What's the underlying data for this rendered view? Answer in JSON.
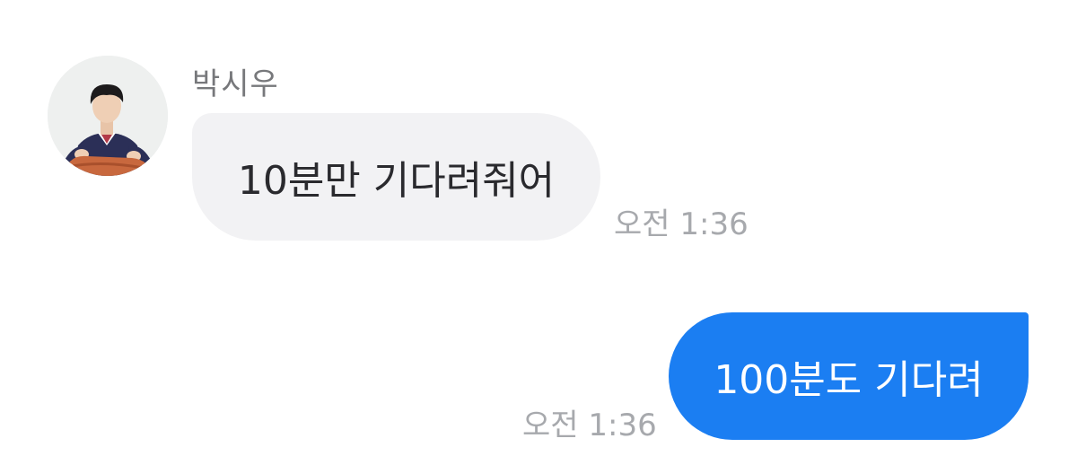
{
  "conversation": {
    "received": {
      "sender_name": "박시우",
      "avatar_icon": "profile-photo",
      "text": "10분만 기다려줘어",
      "time": "오전 1:36"
    },
    "sent": {
      "text": "100분도 기다려",
      "time": "오전 1:36"
    }
  },
  "colors": {
    "sent_bubble": "#1b7ef2",
    "received_bubble": "#f2f2f4",
    "timestamp": "#a7a9ad",
    "sender_name": "#77787b"
  }
}
